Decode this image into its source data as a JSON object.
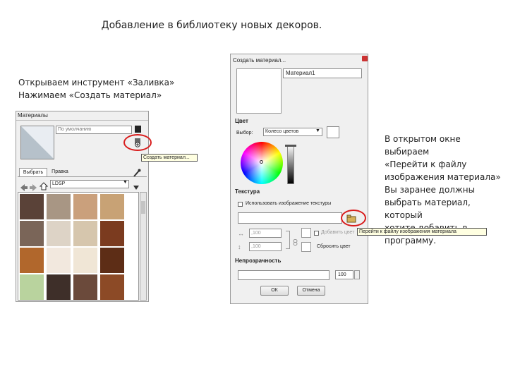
{
  "slide": {
    "title": "Добавление в библиотеку новых декоров.",
    "left_text": [
      "Открываем инструмент «Заливка»",
      "Нажимаем «Создать материал»"
    ],
    "right_text": [
      "В открытом окне выбираем",
      "«Перейти к файлу",
      "изображения материала»",
      "Вы заранее должны",
      "выбрать материал, который",
      "хотите добавить в",
      "программу."
    ]
  },
  "materials_window": {
    "title": "Материалы",
    "name_field": "По умолчанию",
    "tooltip": "Создать материал...",
    "tabs": [
      "Выбрать",
      "Правка"
    ],
    "collection": "LDSP",
    "swatch_colors": [
      "#5a4238",
      "#a89684",
      "#caa07c",
      "#c8a275",
      "#7a6558",
      "#ddd3c6",
      "#d6c6ad",
      "#7b3b1f",
      "#b1672c",
      "#f2e8de",
      "#f0e6d6",
      "#5d2d16",
      "#b9d39e",
      "#3e2f29",
      "#6b4a3b",
      "#8c4a26",
      "#7c5a44",
      "#7a5034",
      "#d9b98a",
      "#f0d19f"
    ]
  },
  "create_material_window": {
    "title": "Создать материал...",
    "name_field": "Материал1",
    "color_section": "Цвет",
    "picker_label": "Выбор:",
    "picker_value": "Колесо цветов",
    "texture_section": "Текстура",
    "use_texture_label": "Использовать изображение текстуры",
    "tooltip": "Перейти к файлу изображения материала",
    "width_value": ",100",
    "height_value": ",100",
    "colorize_label": "Добавить цвет",
    "reset_color_label": "Сбросить цвет",
    "opacity_section": "Непрозрачность",
    "opacity_value": "100",
    "ok_label": "ОК",
    "cancel_label": "Отмена"
  },
  "colors": {
    "highlight": "#d81c1c",
    "tooltip_bg": "#ffffe1"
  }
}
